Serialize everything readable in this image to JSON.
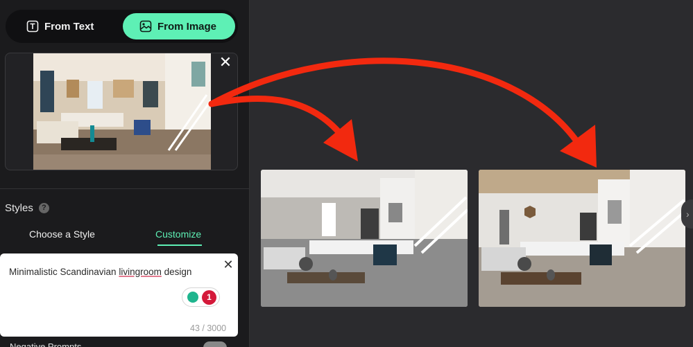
{
  "mode": {
    "from_text_label": "From Text",
    "from_image_label": "From Image",
    "active": "From Image"
  },
  "styles": {
    "label": "Styles",
    "help": "?",
    "tabs": [
      "Choose a Style",
      "Customize"
    ],
    "active_tab": "Customize"
  },
  "prompt": {
    "text_before": "Minimalistic Scandinavian ",
    "text_misspelled": "livingroom",
    "text_after": " design",
    "credit_count": "1",
    "char_count": "43 / 3000"
  },
  "negative_prompts": {
    "label": "Negative Prompts",
    "enabled": false
  },
  "colors": {
    "accent": "#5ef0b5",
    "panel": "#1b1b1d",
    "canvas": "#2b2b2e",
    "arrow": "#f2290f",
    "badge": "#d4193a"
  },
  "icons": {
    "from_text": "text-box-icon",
    "from_image": "image-icon",
    "close": "close-icon",
    "next": "chevron-right-icon",
    "credit": "lightbulb-icon"
  }
}
